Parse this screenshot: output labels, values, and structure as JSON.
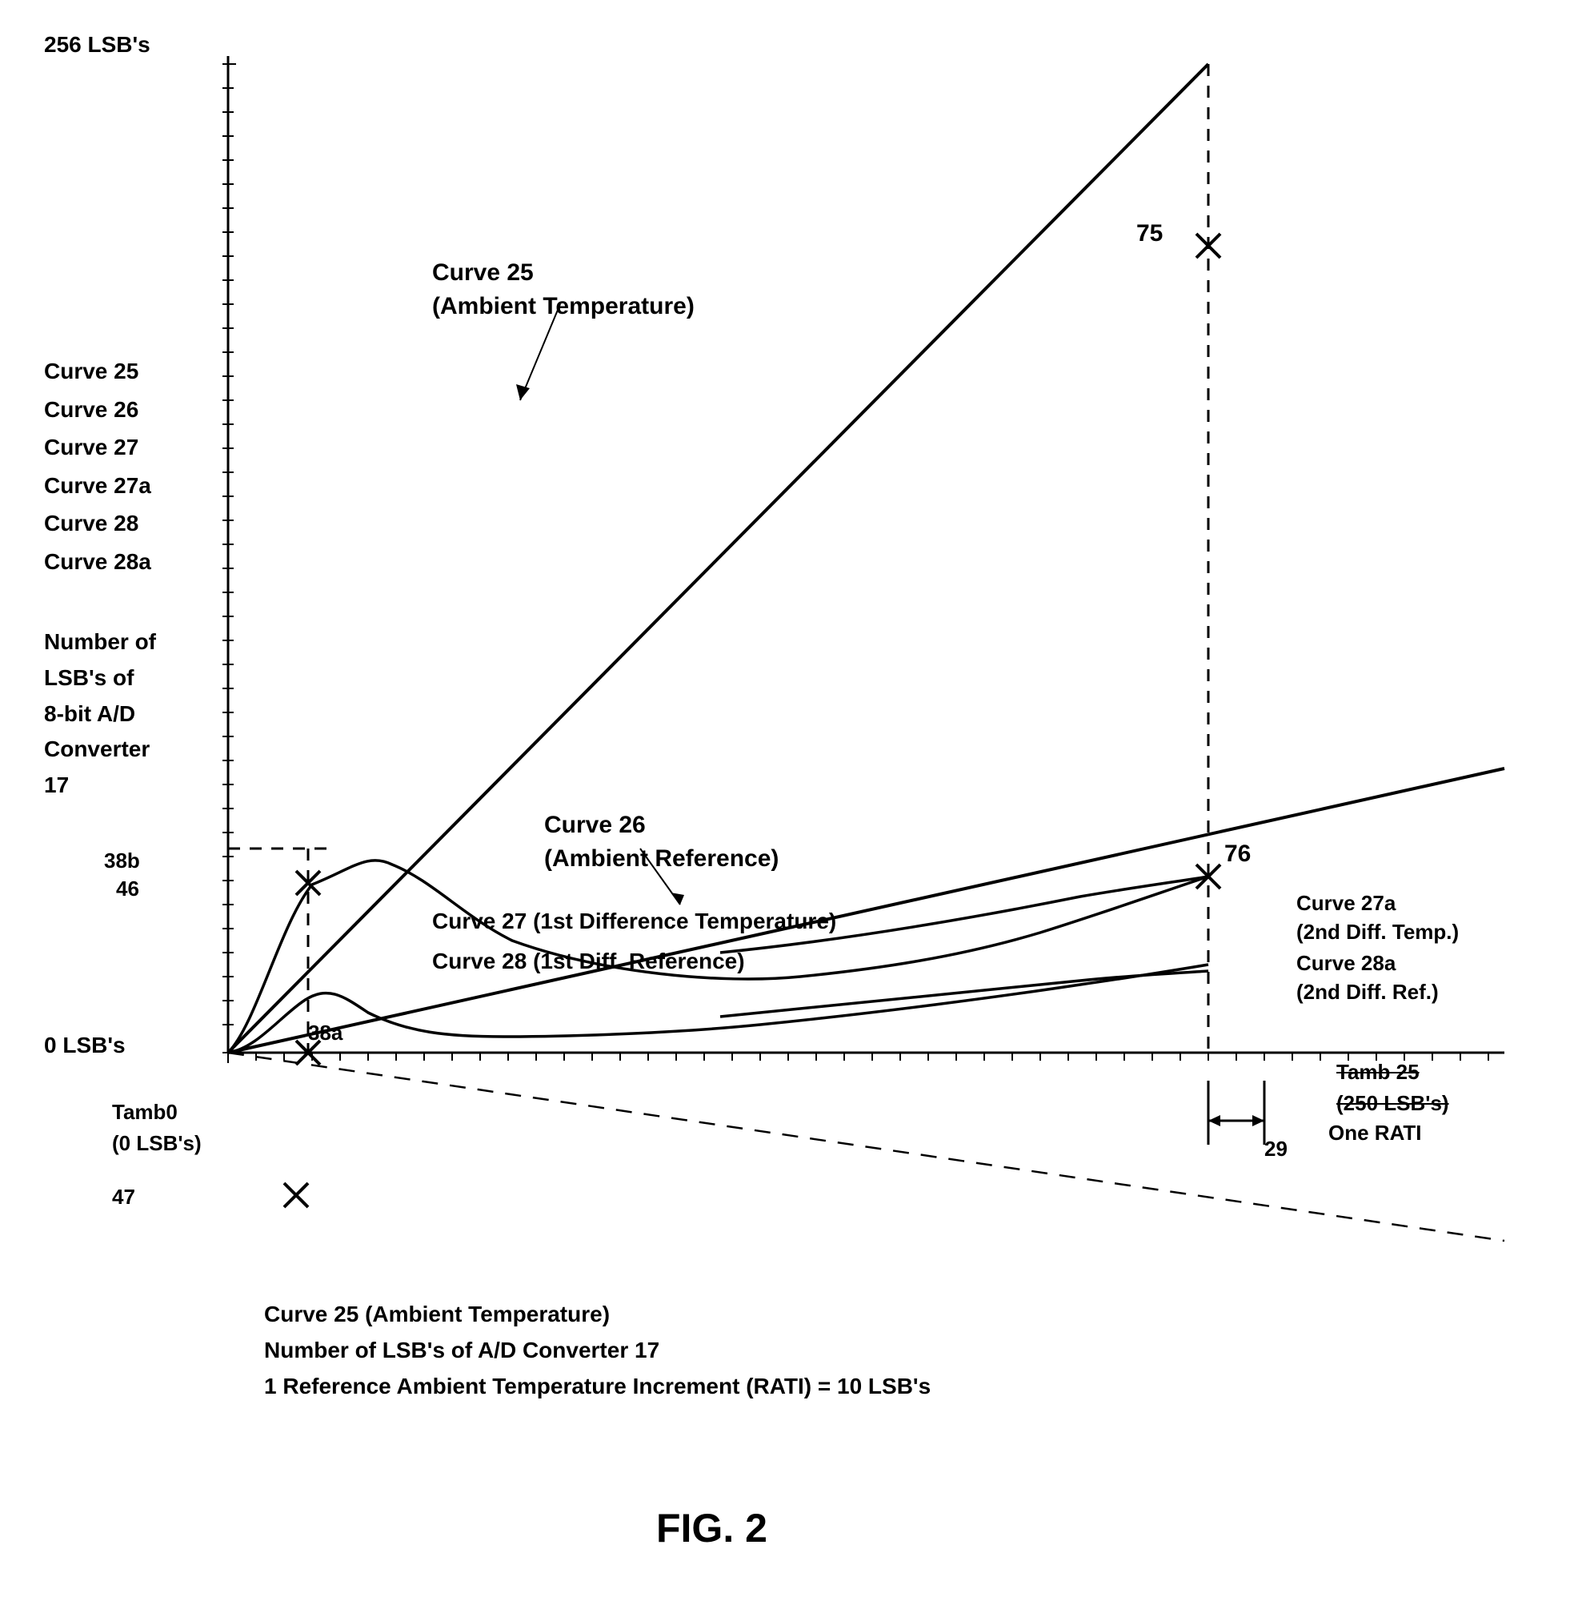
{
  "title": "FIG. 2",
  "y_axis_top": "256 LSB's",
  "y_axis_zero": "0 LSB's",
  "legend": {
    "items": [
      "Curve 25",
      "Curve 26",
      "Curve 27",
      "Curve 27a",
      "Curve 28",
      "Curve 28a"
    ]
  },
  "y_axis_desc": {
    "line1": "Number of",
    "line2": "LSB's of",
    "line3": "8-bit A/D",
    "line4": "Converter",
    "line5": "17"
  },
  "point_labels": {
    "p75": "75",
    "p76": "76",
    "p29": "29",
    "p38a": "38a",
    "p38b": "38b",
    "p46": "46",
    "p47": "47"
  },
  "curve_annotations": {
    "curve25": "Curve 25\n(Ambient Temperature)",
    "curve26": "Curve 26\n(Ambient Reference)",
    "curve27": "Curve 27 (1st Difference Temperature)",
    "curve28": "Curve 28 (1st Diff. Reference)",
    "curve27a": "Curve 27a\n(2nd Diff. Temp.)",
    "curve28a": "Curve 28a\n(2nd Diff. Ref.)"
  },
  "tamb0": "Tamb0\n(0 LSB's)",
  "tamb25": "Tamb 25\n(250 LSB's)",
  "one_rati": "One RATI",
  "bottom_caption": {
    "line1": "Curve 25 (Ambient Temperature)",
    "line2": "Number of LSB's of A/D Converter 17",
    "line3": "1 Reference Ambient Temperature Increment (RATI) = 10 LSB's"
  },
  "fig": "FIG. 2"
}
